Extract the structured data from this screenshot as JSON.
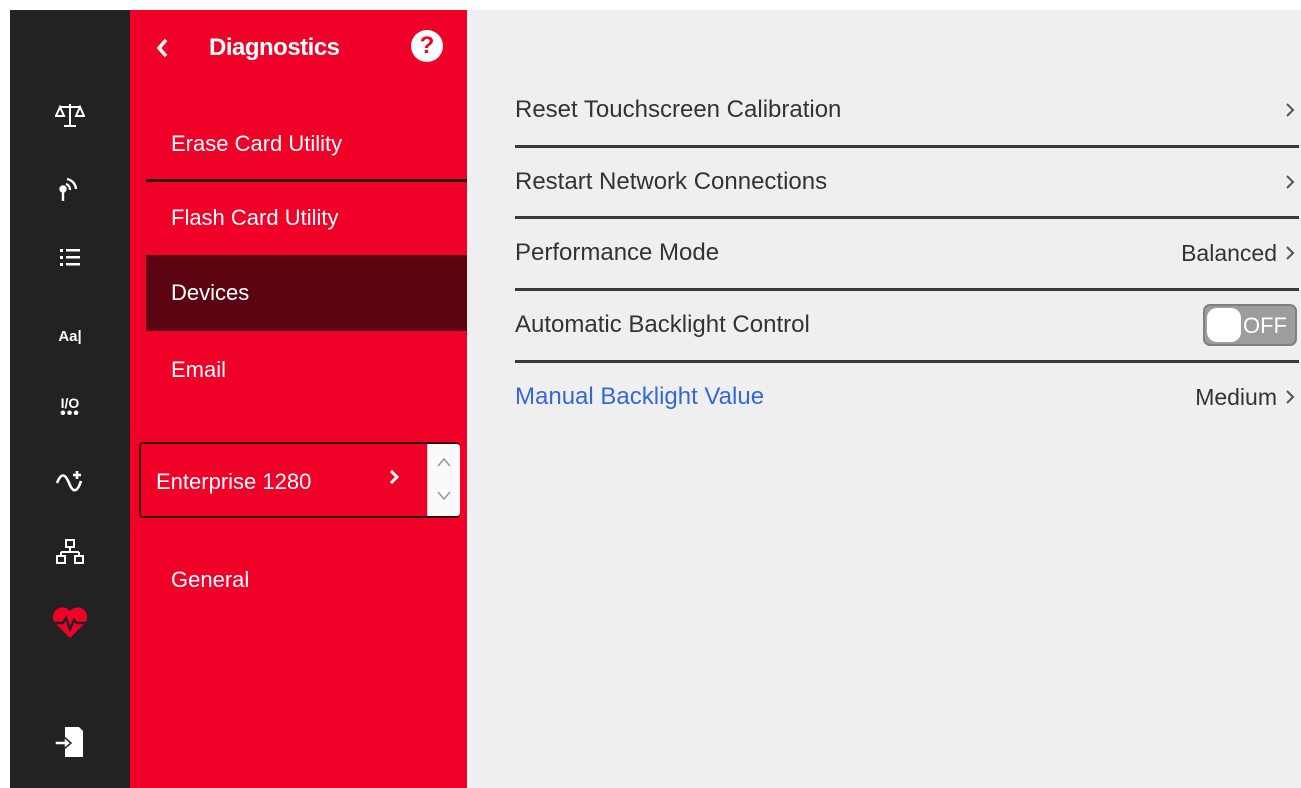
{
  "rail": {
    "font_icon_label": "Aa|",
    "io_icon_label": "I/O"
  },
  "menu": {
    "title": "Diagnostics",
    "help_glyph": "?",
    "items": [
      {
        "label": "Erase Card Utility"
      },
      {
        "label": "Flash Card Utility"
      },
      {
        "label": "Devices",
        "active": true
      },
      {
        "label": "Email"
      }
    ],
    "enterprise": {
      "label": "Enterprise 1280"
    },
    "general": {
      "label": "General"
    }
  },
  "content": {
    "rows": [
      {
        "label": "Reset Touchscreen Calibration",
        "value": ""
      },
      {
        "label": "Restart Network Connections",
        "value": ""
      },
      {
        "label": "Performance Mode",
        "value": "Balanced"
      },
      {
        "label": "Automatic Backlight Control",
        "toggle_state": "OFF"
      },
      {
        "label": "Manual Backlight Value",
        "value": "Medium"
      }
    ]
  },
  "colors": {
    "menu_red": "#f00128",
    "rail_dark": "#222222",
    "active_item": "#5c0412",
    "content_bg": "#f0eff0",
    "link_blue": "#3468d8"
  }
}
